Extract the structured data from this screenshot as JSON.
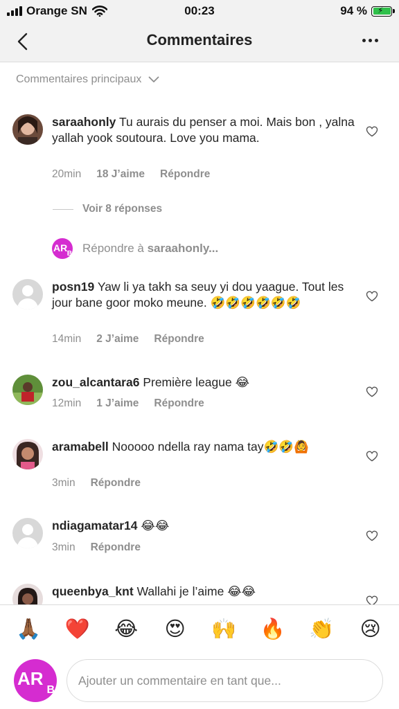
{
  "status_bar": {
    "carrier": "Orange SN",
    "time": "00:23",
    "battery": "94 %"
  },
  "header": {
    "title": "Commentaires"
  },
  "filter": {
    "label": "Commentaires principaux"
  },
  "comments": [
    {
      "username": "saraahonly",
      "text": "Tu aurais du penser a moi. Mais bon , yalna yallah yook  soutoura. Love you mama.",
      "time": "20min",
      "likes": "18 J’aime",
      "reply": "Répondre"
    },
    {
      "username": "posn19",
      "text": "Yaw li ya takh sa seuy yi dou yaague. Tout les jour bane goor moko meune. 🤣🤣🤣🤣🤣🤣",
      "time": "14min",
      "likes": "2 J’aime",
      "reply": "Répondre"
    },
    {
      "username": "zou_alcantara6",
      "text": "Première league 😂",
      "time": "12min",
      "likes": "1 J’aime",
      "reply": "Répondre"
    },
    {
      "username": "aramabell",
      "text": "Nooooo ndella ray nama tay🤣🤣🙆",
      "time": "3min",
      "reply": "Répondre"
    },
    {
      "username": "ndiagamatar14",
      "text": "😂😂",
      "time": "3min",
      "reply": "Répondre"
    },
    {
      "username": "queenbya_knt",
      "text": "Wallahi je l’aime 😂😂"
    }
  ],
  "replies_toggle": "Voir 8 réponses",
  "reply_to": {
    "prefix": "Répondre à",
    "username": "saraahonly..."
  },
  "avatar_initials": {
    "main": "AR",
    "sub": "B"
  },
  "emoji_bar": [
    "🙏🏾",
    "❤️",
    "😂",
    "😍",
    "🙌",
    "🔥",
    "👏",
    "😢"
  ],
  "input": {
    "placeholder": "Ajouter un commentaire en tant que..."
  },
  "colors": {
    "avatar_bg": "#d52cd0",
    "muted_text": "#8e8e8e",
    "battery_fill": "#2fc04a"
  }
}
